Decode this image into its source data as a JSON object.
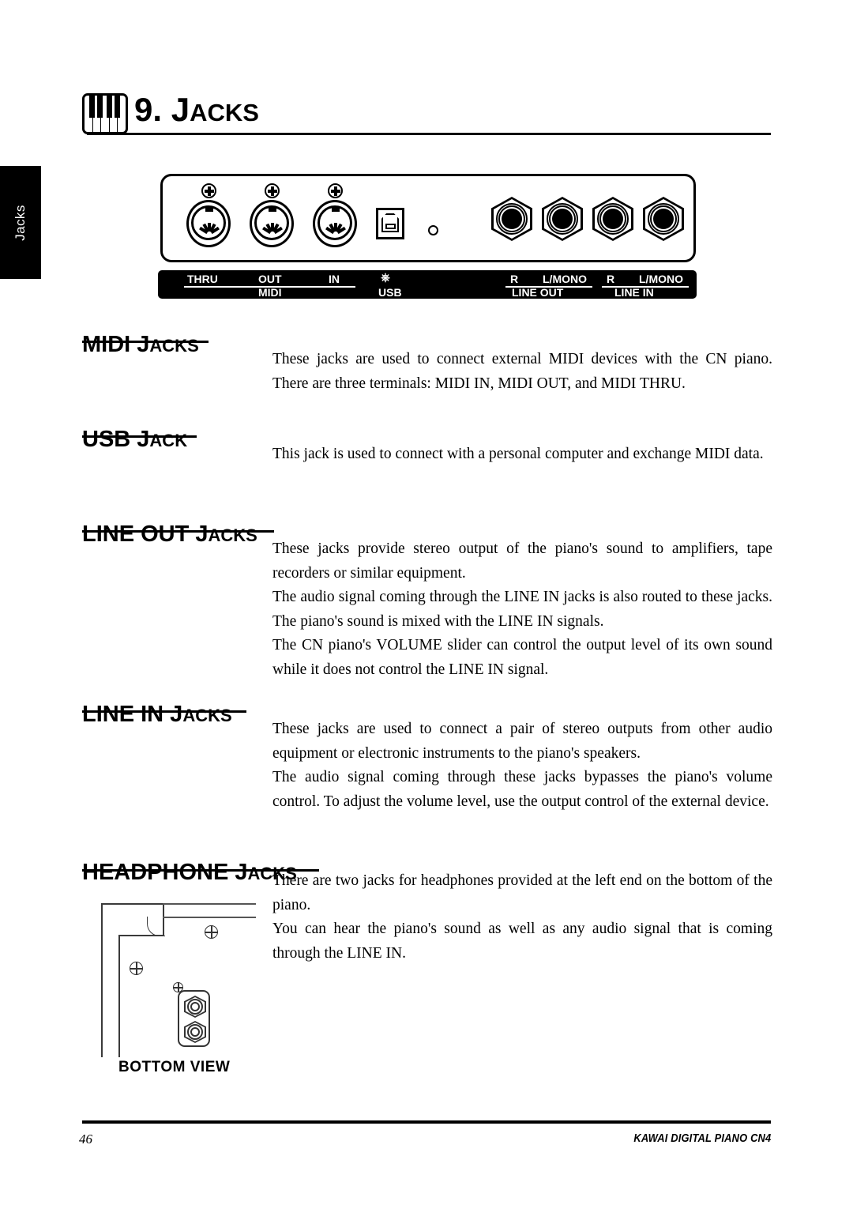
{
  "side_tab": {
    "label": "Jacks"
  },
  "chapter": {
    "number": "9.",
    "title_big": "J",
    "title_small": "ACKS",
    "icon": "piano-keys-icon"
  },
  "panel_figure": {
    "name": "rear-jack-panel-diagram",
    "labels": {
      "midi_thru": "THRU",
      "midi_out": "OUT",
      "midi_in": "IN",
      "midi_group": "MIDI",
      "usb_group": "USB",
      "line_out_r": "R",
      "line_out_l": "L/MONO",
      "line_out_group": "LINE OUT",
      "line_in_r": "R",
      "line_in_l": "L/MONO",
      "line_in_group": "LINE IN"
    }
  },
  "sections": [
    {
      "id": "midi-jacks",
      "head_big": "MIDI J",
      "head_small": "ACKS",
      "paragraphs": [
        "These jacks are used to connect external MIDI devices with the CN piano.",
        "There are three terminals: MIDI IN, MIDI OUT, and MIDI THRU."
      ]
    },
    {
      "id": "usb-jack",
      "head_big": "USB J",
      "head_small": "ACK",
      "paragraphs": [
        "This jack is used to connect with a personal computer and exchange MIDI data."
      ]
    },
    {
      "id": "line-out-jacks",
      "head_big": "LINE OUT J",
      "head_small": "ACKS",
      "paragraphs": [
        "These jacks provide stereo output of the piano's sound to amplifiers, tape recorders or similar equipment.",
        "The audio signal coming through the LINE IN jacks is also routed to these jacks.  The piano's sound is mixed with the LINE IN signals.",
        "The CN piano's VOLUME slider can control the output level of its own sound while it does not control the LINE IN signal."
      ]
    },
    {
      "id": "line-in-jacks",
      "head_big": "LINE IN J",
      "head_small": "ACKS",
      "paragraphs": [
        "These jacks are used to connect a pair of stereo outputs from other audio equipment or electronic instruments to the piano's speakers.",
        "The audio signal coming through these jacks bypasses the piano's volume control.  To adjust the volume level, use the output control of the external device."
      ]
    },
    {
      "id": "headphone-jacks",
      "head_big": "HEADPHONE J",
      "head_small": "ACKS",
      "paragraphs": [
        "There are two jacks for headphones provided at the left end on the bottom of the piano.",
        "You can hear the piano's sound as well as any audio signal that is coming through the LINE IN."
      ]
    }
  ],
  "bottom_figure": {
    "name": "bottom-view-diagram",
    "caption": "BOTTOM VIEW"
  },
  "footer": {
    "page_number": "46",
    "right_text": "KAWAI DIGITAL PIANO CN4"
  },
  "colors": {
    "ink": "#000000",
    "paper": "#ffffff",
    "line_gray": "#3a3a3a"
  }
}
